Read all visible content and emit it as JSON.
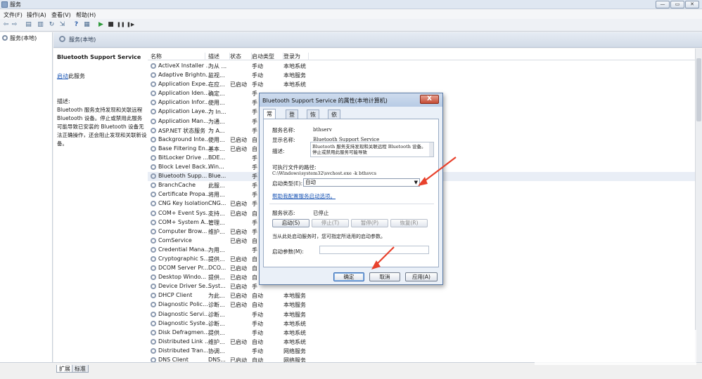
{
  "window": {
    "title": "服务",
    "min_glyph": "—",
    "max_glyph": "▭",
    "close_glyph": "✕"
  },
  "menu": [
    "文件(F)",
    "操作(A)",
    "查看(V)",
    "帮助(H)"
  ],
  "toolbar": [
    "back-icon",
    "forward-icon",
    "console-tree-icon",
    "properties-icon",
    "refresh-icon",
    "export-icon",
    "help-icon",
    "view-icon",
    "start-icon",
    "stop-icon",
    "pause-icon",
    "restart-icon"
  ],
  "toolbar_glyphs": {
    "back": "⇦",
    "forward": "⇨",
    "tree": "▤",
    "props": "▥",
    "refresh": "↻",
    "export": "⇲",
    "help": "?",
    "view": "▦",
    "start": "▶",
    "stop": "■",
    "pause": "❚❚",
    "restart": "❚▶"
  },
  "tree": {
    "label": "服务(本地)"
  },
  "main_header": {
    "label": "服务(本地)"
  },
  "description_pane": {
    "service_title": "Bluetooth Support Service",
    "start_link": "启动",
    "start_suffix": "此服务",
    "desc_label": "描述:",
    "desc_text": "Bluetooth 服务支持发现和关联远程 Bluetooth 设备。停止或禁用此服务可能导致已安装的 Bluetooth 设备无法正确操作，还会阻止发现和关联新设备。"
  },
  "columns": [
    "名称",
    "描述",
    "状态",
    "启动类型",
    "登录为"
  ],
  "services": [
    {
      "name": "ActiveX Installer ...",
      "desc": "为从 ...",
      "status": "",
      "startup": "手动",
      "logon": "本地系统"
    },
    {
      "name": "Adaptive Brightn...",
      "desc": "监视...",
      "status": "",
      "startup": "手动",
      "logon": "本地服务"
    },
    {
      "name": "Application Expe...",
      "desc": "在应...",
      "status": "已启动",
      "startup": "手动",
      "logon": "本地系统"
    },
    {
      "name": "Application Iden...",
      "desc": "确定...",
      "status": "",
      "startup": "手",
      "logon": ""
    },
    {
      "name": "Application Infor...",
      "desc": "使用...",
      "status": "",
      "startup": "手",
      "logon": ""
    },
    {
      "name": "Application Laye...",
      "desc": "为 In...",
      "status": "",
      "startup": "手",
      "logon": ""
    },
    {
      "name": "Application Man...",
      "desc": "为通...",
      "status": "",
      "startup": "手",
      "logon": ""
    },
    {
      "name": "ASP.NET 状态服务",
      "desc": "为 A...",
      "status": "",
      "startup": "手",
      "logon": ""
    },
    {
      "name": "Background Inte...",
      "desc": "使用...",
      "status": "已启动",
      "startup": "自",
      "logon": ""
    },
    {
      "name": "Base Filtering En...",
      "desc": "基本...",
      "status": "已启动",
      "startup": "自",
      "logon": ""
    },
    {
      "name": "BitLocker Drive ...",
      "desc": "BDE...",
      "status": "",
      "startup": "手",
      "logon": ""
    },
    {
      "name": "Block Level Back...",
      "desc": "Win...",
      "status": "",
      "startup": "手",
      "logon": ""
    },
    {
      "name": "Bluetooth Supp...",
      "desc": "Blue...",
      "status": "",
      "startup": "手",
      "logon": ""
    },
    {
      "name": "BranchCache",
      "desc": "此服...",
      "status": "",
      "startup": "手",
      "logon": ""
    },
    {
      "name": "Certificate Propa...",
      "desc": "将用...",
      "status": "",
      "startup": "手",
      "logon": ""
    },
    {
      "name": "CNG Key Isolation",
      "desc": "CNG...",
      "status": "已启动",
      "startup": "手",
      "logon": ""
    },
    {
      "name": "COM+ Event Sys...",
      "desc": "支持...",
      "status": "已启动",
      "startup": "自",
      "logon": ""
    },
    {
      "name": "COM+ System A...",
      "desc": "管理...",
      "status": "",
      "startup": "手",
      "logon": ""
    },
    {
      "name": "Computer Brow...",
      "desc": "维护...",
      "status": "已启动",
      "startup": "手",
      "logon": ""
    },
    {
      "name": "ComService",
      "desc": "",
      "status": "已启动",
      "startup": "自",
      "logon": ""
    },
    {
      "name": "Credential Mana...",
      "desc": "为用...",
      "status": "",
      "startup": "手",
      "logon": ""
    },
    {
      "name": "Cryptographic S...",
      "desc": "提供...",
      "status": "已启动",
      "startup": "自",
      "logon": ""
    },
    {
      "name": "DCOM Server Pr...",
      "desc": "DCO...",
      "status": "已启动",
      "startup": "自",
      "logon": ""
    },
    {
      "name": "Desktop Windo...",
      "desc": "提供...",
      "status": "已启动",
      "startup": "自",
      "logon": ""
    },
    {
      "name": "Device Driver Se...",
      "desc": "Syst...",
      "status": "已启动",
      "startup": "手",
      "logon": ""
    },
    {
      "name": "DHCP Client",
      "desc": "为此...",
      "status": "已启动",
      "startup": "自动",
      "logon": "本地服务"
    },
    {
      "name": "Diagnostic Polic...",
      "desc": "诊断...",
      "status": "已启动",
      "startup": "自动",
      "logon": "本地服务"
    },
    {
      "name": "Diagnostic Servi...",
      "desc": "诊断...",
      "status": "",
      "startup": "手动",
      "logon": "本地服务"
    },
    {
      "name": "Diagnostic Syste...",
      "desc": "诊断...",
      "status": "",
      "startup": "手动",
      "logon": "本地系统"
    },
    {
      "name": "Disk Defragmen...",
      "desc": "提供...",
      "status": "",
      "startup": "手动",
      "logon": "本地系统"
    },
    {
      "name": "Distributed Link ...",
      "desc": "维护...",
      "status": "已启动",
      "startup": "自动",
      "logon": "本地系统"
    },
    {
      "name": "Distributed Tran...",
      "desc": "协调...",
      "status": "",
      "startup": "手动",
      "logon": "网络服务"
    },
    {
      "name": "DNS Client",
      "desc": "DNS...",
      "status": "已启动",
      "startup": "自动",
      "logon": "网络服务"
    }
  ],
  "bottom_tabs": [
    "扩展",
    "标准"
  ],
  "dialog": {
    "title": "Bluetooth Support Service 的属性(本地计算机)",
    "close": "X",
    "tabs": [
      "常规",
      "登录",
      "恢复",
      "依存关系"
    ],
    "service_name_label": "服务名称:",
    "service_name": "bthserv",
    "display_name_label": "显示名称:",
    "display_name": "Bluetooth Support Service",
    "desc_label": "描述:",
    "desc_value": "Bluetooth 服务支持发现和关联远程 Bluetooth 设备。停止或禁用此服务可能导致",
    "exe_path_label": "可执行文件的路径:",
    "exe_path": "C:\\Windows\\system32\\svchost.exe -k bthsvcs",
    "startup_type_label": "启动类型(E):",
    "startup_type": "自动",
    "help_link": "帮助我配置服务启动选项。",
    "status_label": "服务状态:",
    "status_value": "已停止",
    "btn_start": "启动(S)",
    "btn_stop": "停止(T)",
    "btn_pause": "暂停(P)",
    "btn_resume": "恢复(R)",
    "hint": "当从此处启动服务时，您可指定所适用的启动参数。",
    "param_label": "启动参数(M):",
    "param_value": "",
    "ok": "确定",
    "cancel": "取消",
    "apply": "应用(A)"
  },
  "annotation_color": "#e8412c"
}
